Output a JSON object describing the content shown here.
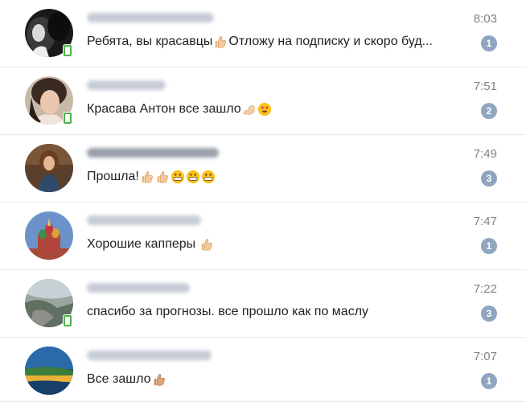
{
  "dialogs": [
    {
      "time": "8:03",
      "message": "Ребята, вы красавцы",
      "message_tail": " Отложу на подписку и скоро буд...",
      "unread": "1",
      "emojis": [
        "thumbs-up-emoji"
      ],
      "online_mobile": true
    },
    {
      "time": "7:51",
      "message": "Красава Антон все зашло",
      "message_tail": "",
      "unread": "2",
      "emojis": [
        "flexed-biceps-emoji",
        "heart-eyes-emoji"
      ],
      "online_mobile": true
    },
    {
      "time": "7:49",
      "message": "Прошла!",
      "message_tail": "",
      "unread": "3",
      "emojis": [
        "thumbs-up-emoji",
        "thumbs-up-emoji",
        "grinning-face-emoji",
        "grinning-face-emoji",
        "grinning-face-emoji"
      ],
      "online_mobile": false
    },
    {
      "time": "7:47",
      "message": "Хорошие капперы",
      "message_tail": "",
      "unread": "1",
      "emojis": [
        "thumbs-up-emoji"
      ],
      "online_mobile": false
    },
    {
      "time": "7:22",
      "message": "спасибо за прогнозы. все прошло как по маслу",
      "message_tail": "",
      "unread": "3",
      "emojis": [],
      "online_mobile": true
    },
    {
      "time": "7:07",
      "message": "Все зашло",
      "message_tail": "",
      "unread": "1",
      "emojis": [
        "thumbs-up-emoji"
      ],
      "online_mobile": false
    }
  ],
  "colors": {
    "badge": "#8fa5c0",
    "time": "#828282",
    "text": "#222222",
    "divider": "#e7e8ec",
    "online": "#4bb34b"
  }
}
